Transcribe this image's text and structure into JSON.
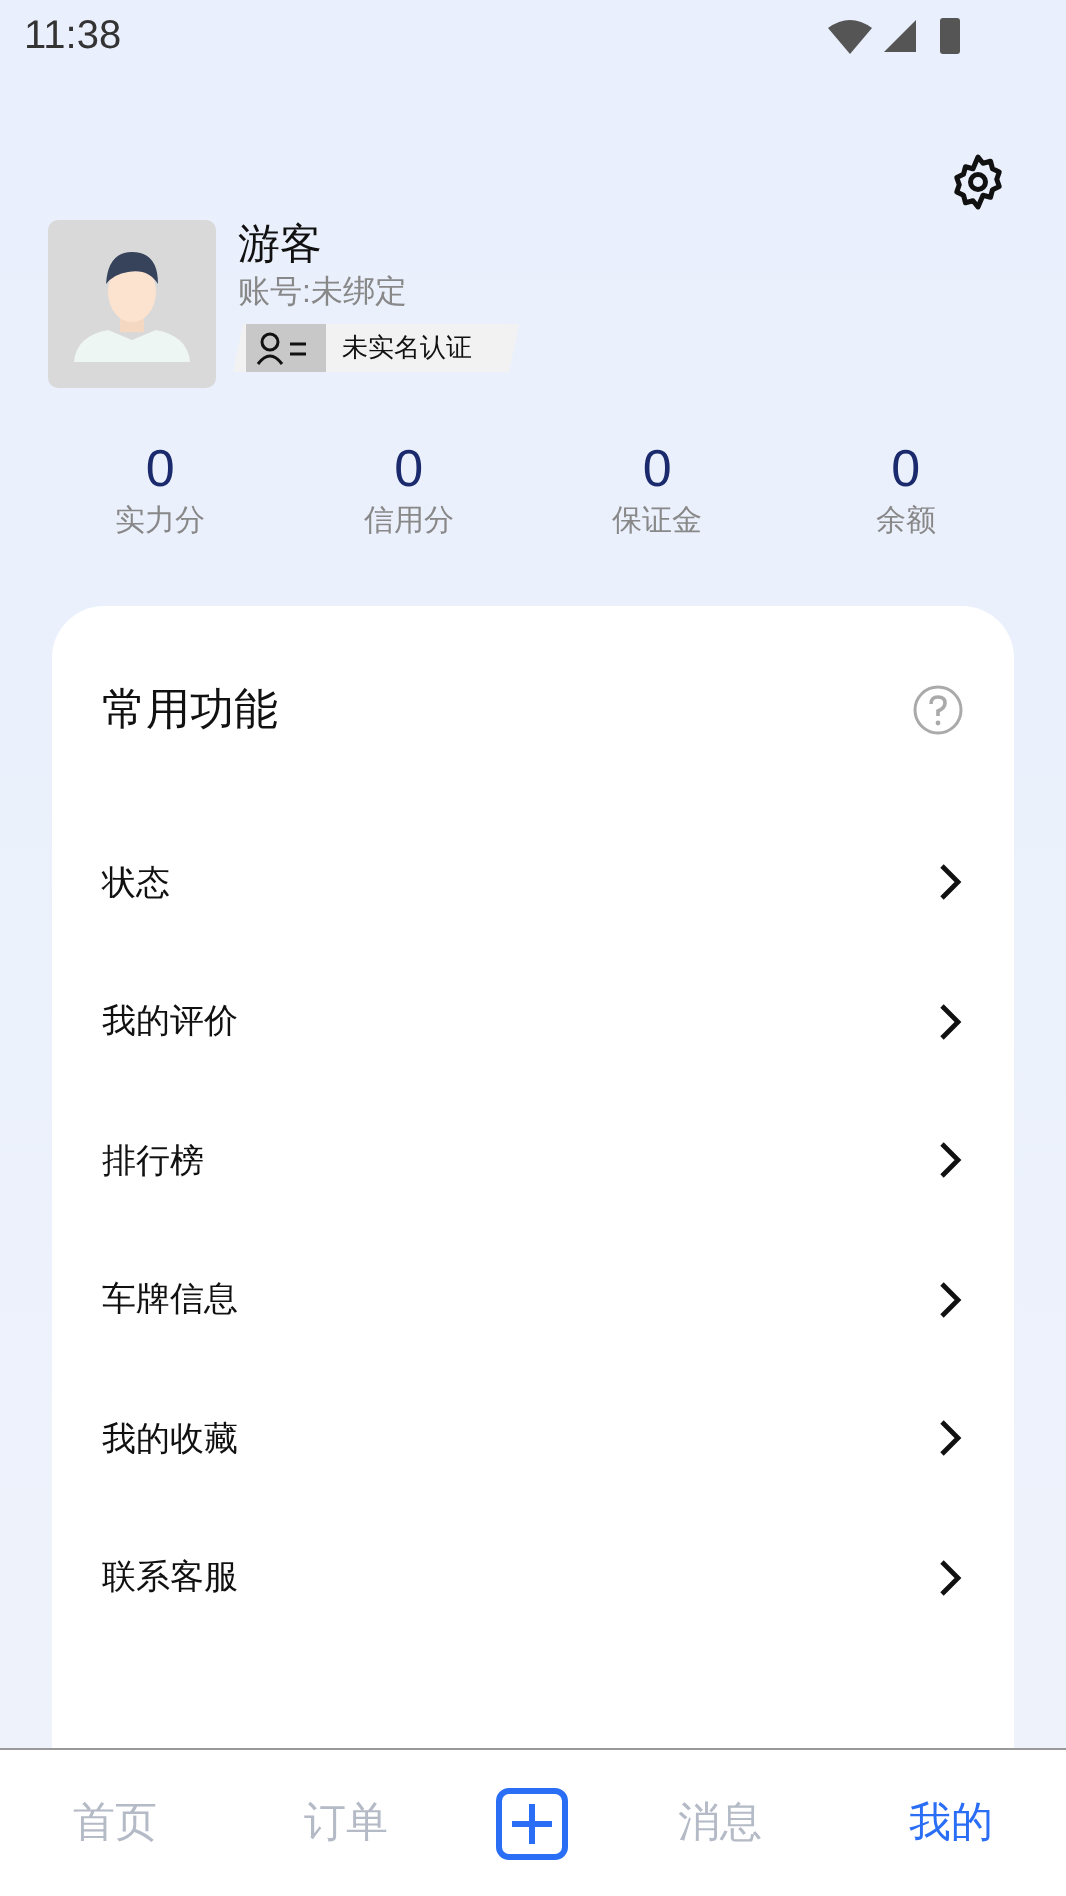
{
  "status_bar": {
    "time": "11:38"
  },
  "profile": {
    "name": "游客",
    "account": "账号:未绑定",
    "verification": "未实名认证"
  },
  "stats": [
    {
      "value": "0",
      "label": "实力分"
    },
    {
      "value": "0",
      "label": "信用分"
    },
    {
      "value": "0",
      "label": "保证金"
    },
    {
      "value": "0",
      "label": "余额"
    }
  ],
  "functions": {
    "title": "常用功能",
    "items": [
      "状态",
      "我的评价",
      "排行榜",
      "车牌信息",
      "我的收藏",
      "联系客服"
    ]
  },
  "bottom_nav": [
    {
      "kind": "tab",
      "label": "首页",
      "selected": false
    },
    {
      "kind": "tab",
      "label": "订单",
      "selected": false
    },
    {
      "kind": "add"
    },
    {
      "kind": "tab",
      "label": "消息",
      "selected": false
    },
    {
      "kind": "tab",
      "label": "我的",
      "selected": true
    }
  ]
}
